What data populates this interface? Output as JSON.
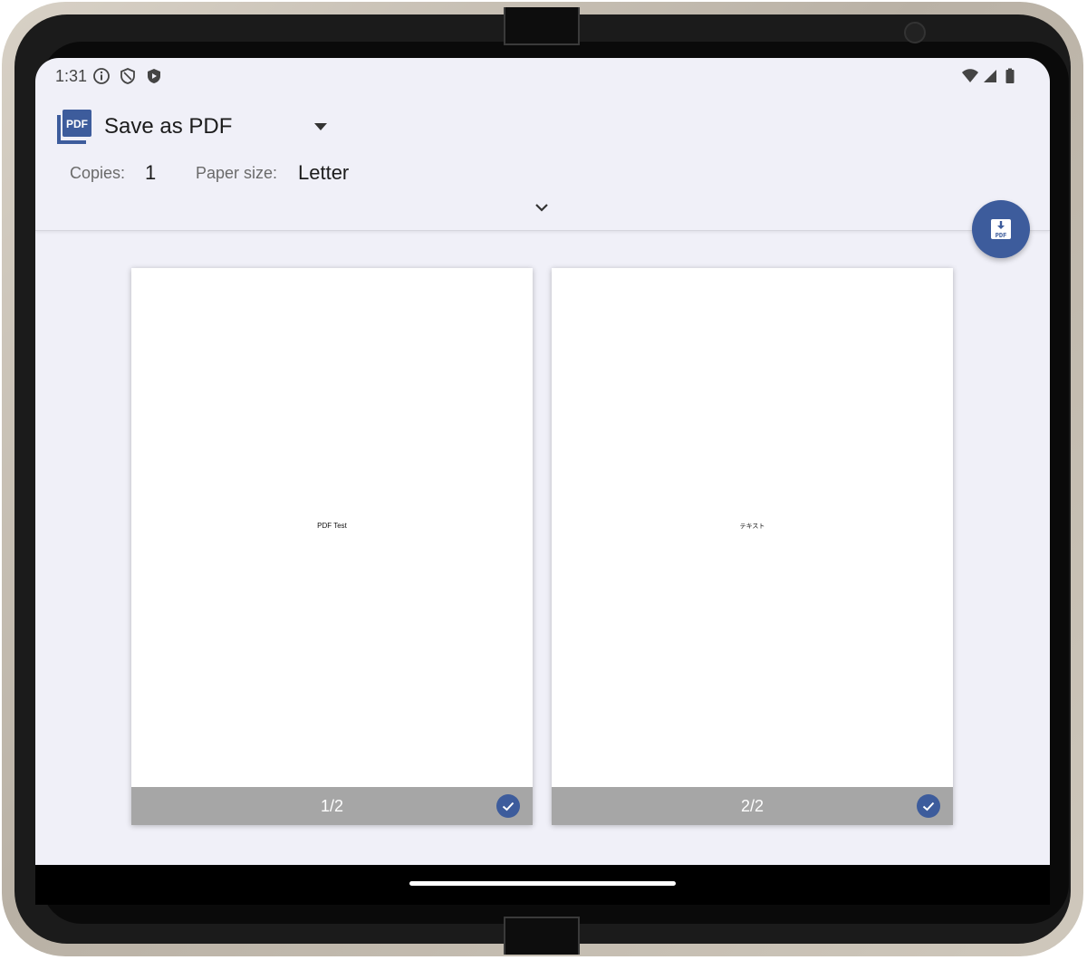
{
  "status_bar": {
    "time": "1:31",
    "left_icons": [
      "info-icon",
      "shield-outline-icon",
      "shield-play-icon"
    ],
    "right_icons": [
      "wifi-icon",
      "cell-signal-icon",
      "battery-icon"
    ]
  },
  "print_dialog": {
    "printer_name": "Save as PDF",
    "copies_label": "Copies:",
    "copies_value": "1",
    "paper_size_label": "Paper size:",
    "paper_size_value": "Letter"
  },
  "fab": {
    "icon": "pdf-download-icon"
  },
  "pages": [
    {
      "content_text": "PDF Test",
      "page_number": "1/2",
      "selected": true
    },
    {
      "content_text": "テキスト",
      "page_number": "2/2",
      "selected": true
    }
  ],
  "colors": {
    "accent": "#3d5c9c",
    "background": "#f0f0f8",
    "page_footer": "#a6a6a6"
  }
}
